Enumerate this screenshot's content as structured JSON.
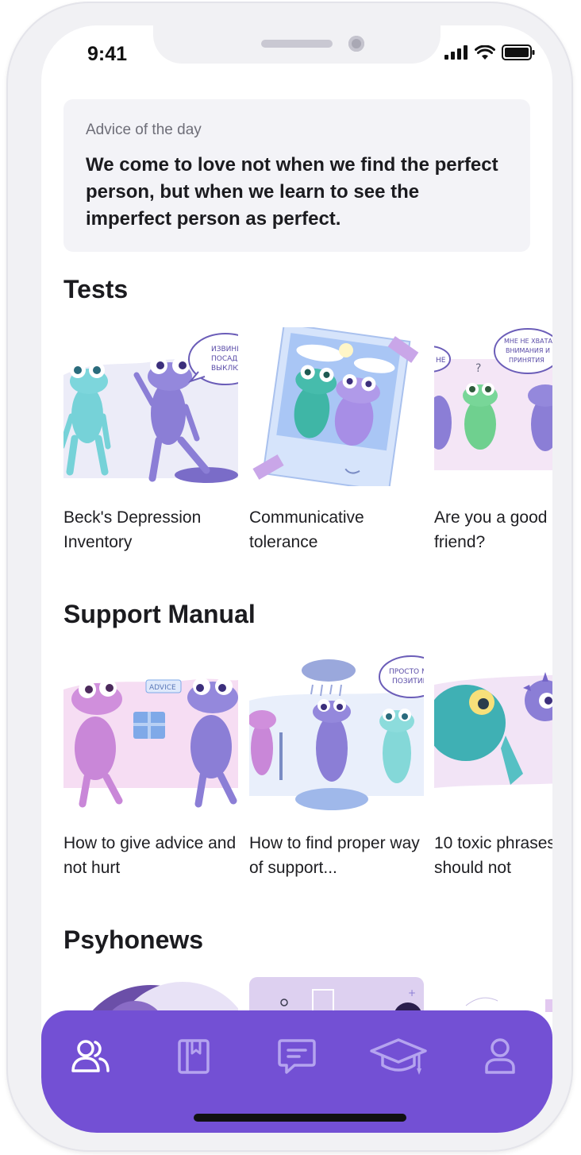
{
  "status_bar": {
    "time": "9:41"
  },
  "advice": {
    "label": "Advice of the day",
    "text": "We come to love not when we find the perfect person, but when we learn to see the imperfect person as perfect."
  },
  "sections": {
    "tests": {
      "title": "Tests",
      "cards": [
        {
          "title": "Beck's Depression Inventory",
          "bubble": "ИЗВИНИ, ПОСАДИ, ВЫКЛЮ"
        },
        {
          "title": "Communicative tolerance"
        },
        {
          "title": "Are you a good friend?",
          "bubble": "МНЕ НЕ ХВАТАЕТ ВНИМАНИЯ И ПРИНЯТИЯ"
        }
      ]
    },
    "support": {
      "title": "Support Manual",
      "cards": [
        {
          "title": "How to give advice and not hurt",
          "tag": "ADVICE"
        },
        {
          "title": "How to find proper way of support...",
          "bubble": "ПРОСТО МЫС ПОЗИТИВН"
        },
        {
          "title": "10 toxic phrases should not"
        }
      ]
    },
    "news": {
      "title": "Psyhonews"
    }
  },
  "tabbar": {
    "icons": [
      "people-icon",
      "book-icon",
      "chat-icon",
      "graduation-cap-icon",
      "profile-icon"
    ],
    "colors": {
      "background": "#7350d4",
      "active": "#ffffff",
      "inactive": "#b5a4ef"
    }
  }
}
